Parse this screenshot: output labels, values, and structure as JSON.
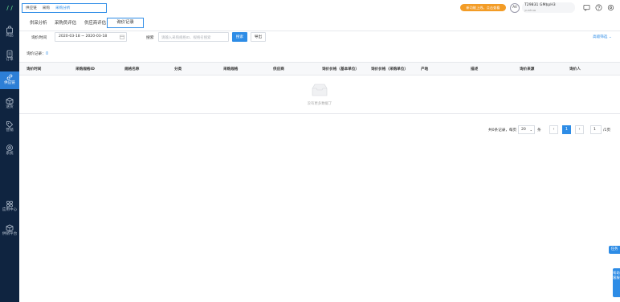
{
  "sidebar": {
    "logo": "/ /",
    "items": [
      {
        "label": "商品",
        "icon": "bag-icon"
      },
      {
        "label": "订单",
        "icon": "document-icon"
      },
      {
        "label": "供应链",
        "icon": "link-icon"
      },
      {
        "label": "送货",
        "icon": "box-icon"
      },
      {
        "label": "营销",
        "icon": "tag-icon"
      },
      {
        "label": "系统",
        "icon": "gear-icon"
      },
      {
        "label": "应用中心",
        "icon": "grid-icon"
      },
      {
        "label": "供销平台",
        "icon": "cube-icon"
      }
    ],
    "active_index": 2
  },
  "breadcrumb": [
    "供应链",
    "采购",
    "采购分析"
  ],
  "header": {
    "notice": "新功能上线，点击查看",
    "avatar": "AV",
    "user_name": "T29831 GM$pH3",
    "user_sub": "yunhuo"
  },
  "tabs": [
    "供采分析",
    "采购员评估",
    "供应商评估",
    "询价记录"
  ],
  "active_tab": 3,
  "filters": {
    "date_label": "询价时间",
    "date_value": "2020-03-18 ~ 2020-03-18",
    "search_label": "搜索",
    "search_placeholder": "请输入采购规格ID、规格名搜索",
    "search_button": "搜索",
    "export_button": "导出",
    "advanced": "高级筛选"
  },
  "count": {
    "label": "询价记录：",
    "value": "0"
  },
  "table": {
    "columns": [
      "询价时间",
      "采购规格ID",
      "规格名称",
      "分类",
      "采购规格",
      "供应商",
      "询价价格（基本单位）",
      "询价价格（采购单位）",
      "产地",
      "描述",
      "询价来源",
      "询价人"
    ],
    "empty_text": "没有更多数据了"
  },
  "pagination": {
    "total_text": "共0条记录，每页",
    "page_size": "20",
    "unit": "条",
    "prev": "‹",
    "current": "1",
    "next": "›",
    "go_value": "1",
    "go_unit": "/1页"
  },
  "float": {
    "task": "任务",
    "help": "帮助客服"
  },
  "colors": {
    "sidebar": "#0f2440",
    "accent": "#2d8ce6",
    "notice": "#f39c26"
  }
}
